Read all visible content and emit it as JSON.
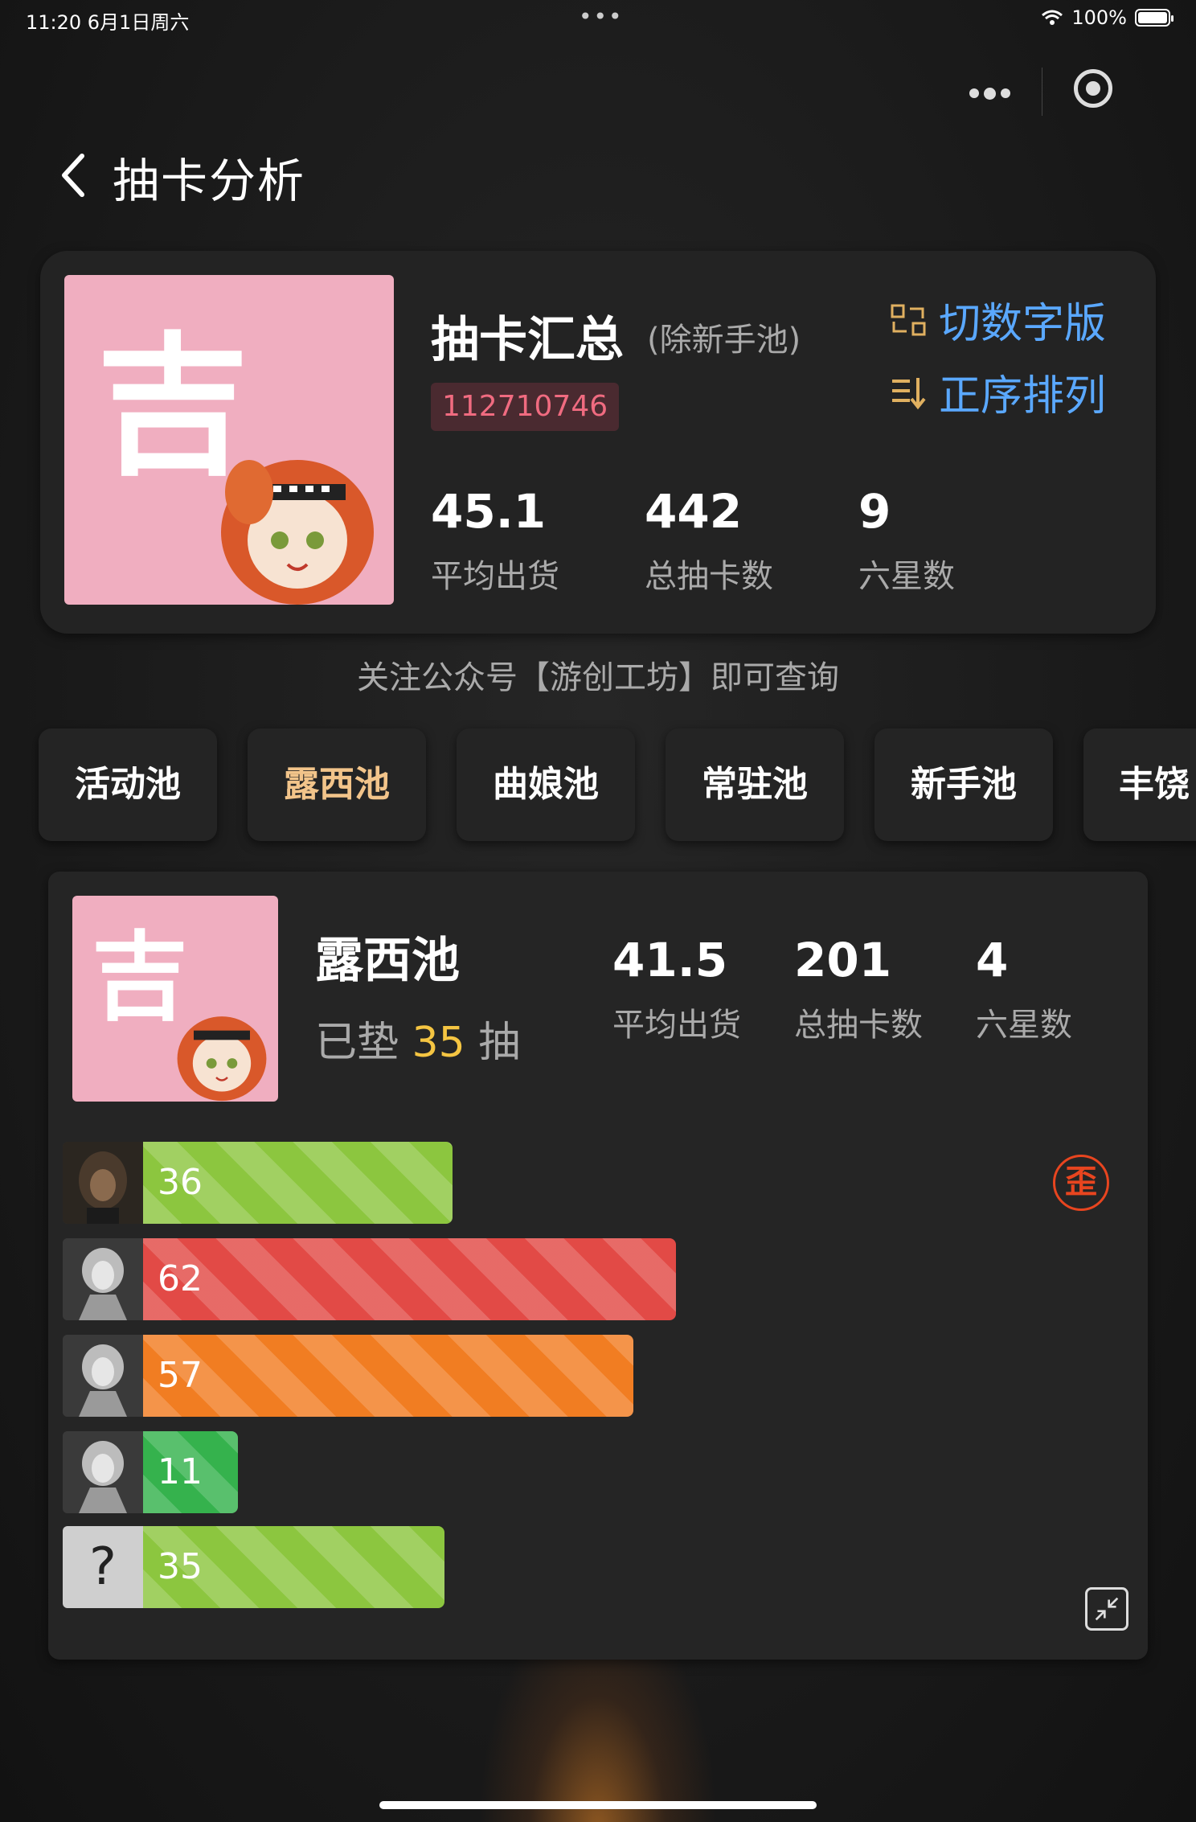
{
  "status": {
    "time_date": "11:20   6月1日周六",
    "dots": "•••",
    "battery": "100%"
  },
  "nav": {
    "title": "抽卡分析"
  },
  "summary": {
    "avatar_char": "吉",
    "title": "抽卡汇总",
    "subtitle": "(除新手池)",
    "uid": "112710746",
    "switch_label": "切数字版",
    "sort_label": "正序排列",
    "stats": [
      {
        "value": "45.1",
        "label": "平均出货"
      },
      {
        "value": "442",
        "label": "总抽卡数"
      },
      {
        "value": "9",
        "label": "六星数"
      }
    ]
  },
  "follow_text": "关注公众号【游创工坊】即可查询",
  "tabs": [
    "活动池",
    "露西池",
    "曲娘池",
    "常驻池",
    "新手池",
    "丰饶"
  ],
  "active_tab": 1,
  "pool": {
    "avatar_char": "吉",
    "name": "露西池",
    "pity_prefix": "已垫",
    "pity_value": "35",
    "pity_suffix": "抽",
    "stats": [
      {
        "value": "41.5",
        "label": "平均出货"
      },
      {
        "value": "201",
        "label": "总抽卡数"
      },
      {
        "value": "4",
        "label": "六星数"
      }
    ],
    "wai_badge": "歪",
    "pulls": [
      {
        "value": 36,
        "color": "green",
        "thumb": "character-portrait-icon"
      },
      {
        "value": 62,
        "color": "red",
        "thumb": "silver-character-icon"
      },
      {
        "value": 57,
        "color": "orange",
        "thumb": "silver-character-icon"
      },
      {
        "value": 11,
        "color": "dgreen",
        "thumb": "silver-character-icon"
      },
      {
        "value": 35,
        "color": "green",
        "thumb": "unknown-question-icon",
        "thumb_text": "?"
      }
    ]
  }
}
